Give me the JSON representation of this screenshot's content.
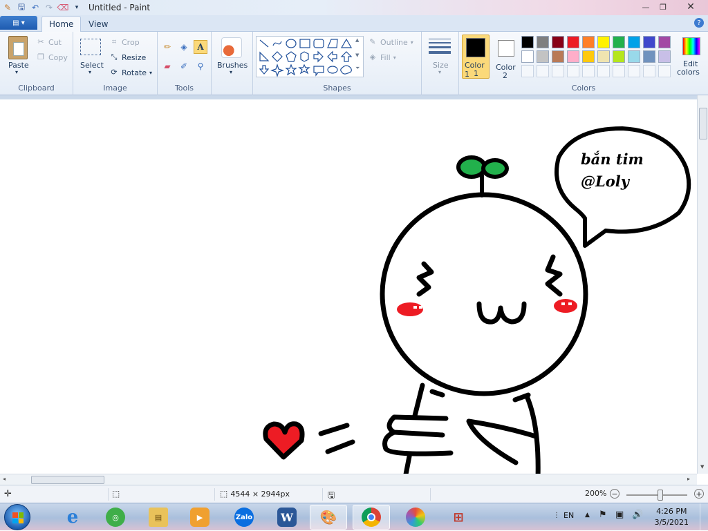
{
  "window": {
    "title": "Untitled - Paint"
  },
  "tabs": {
    "file_icon": "▤ ▾",
    "home": "Home",
    "view": "View"
  },
  "clipboard": {
    "paste": "Paste",
    "cut": "Cut",
    "copy": "Copy",
    "label": "Clipboard"
  },
  "image": {
    "select": "Select",
    "crop": "Crop",
    "resize": "Resize",
    "rotate": "Rotate",
    "label": "Image"
  },
  "tools": {
    "label": "Tools"
  },
  "brushes": {
    "label": "Brushes"
  },
  "shapes": {
    "outline": "Outline",
    "fill": "Fill",
    "label": "Shapes"
  },
  "size": {
    "label": "Size"
  },
  "colors": {
    "color1": "Color 1",
    "color1_line2": "1",
    "color2": "Color",
    "color2_line2": "2",
    "edit": "Edit",
    "edit_line2": "colors",
    "label": "Colors",
    "row1": [
      "#000000",
      "#7f7f7f",
      "#880015",
      "#ed1c24",
      "#ff7f27",
      "#fff200",
      "#22b14c",
      "#00a2e8",
      "#3f48cc",
      "#a349a4"
    ],
    "row2": [
      "#ffffff",
      "#c3c3c3",
      "#b97a57",
      "#ffaec9",
      "#ffc90e",
      "#efe4b0",
      "#b5e61d",
      "#99d9ea",
      "#7092be",
      "#c8bfe7"
    ]
  },
  "canvas": {
    "bubble_line1": "bắn tim",
    "bubble_line2": "@Loly"
  },
  "status": {
    "dimensions": "4544 × 2944px",
    "zoom": "200%"
  },
  "taskbar": {
    "lang": "EN",
    "time": "4:26 PM",
    "date": "3/5/2021",
    "zalo": "Zalo",
    "word": "W"
  }
}
